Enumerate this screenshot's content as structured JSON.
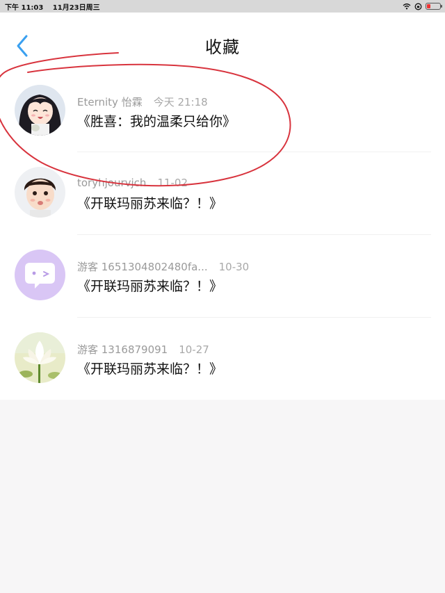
{
  "status_bar": {
    "time": "下午 11:03",
    "date": "11月23日周三"
  },
  "header": {
    "title": "收藏"
  },
  "favorites": [
    {
      "author": "Eternity 怡霖",
      "date": "今天 21:18",
      "title": "《胜喜：我的温柔只给你》",
      "avatar": "anime-girl-avatar"
    },
    {
      "author": "toryhjourvjch",
      "date": "11-02",
      "title": "《开联玛丽苏来临？！》",
      "avatar": "child-photo-avatar"
    },
    {
      "author": "游客 1651304802480fa...",
      "date": "10-30",
      "title": "《开联玛丽苏来临？！》",
      "avatar": "chat-bubble-avatar"
    },
    {
      "author": "游客 1316879091",
      "date": "10-27",
      "title": "《开联玛丽苏来临？！》",
      "avatar": "lotus-flower-avatar"
    }
  ],
  "colors": {
    "accent": "#3aa0f0",
    "annotation": "#d8333d",
    "chat_avatar_bg": "#d9c6f5"
  }
}
